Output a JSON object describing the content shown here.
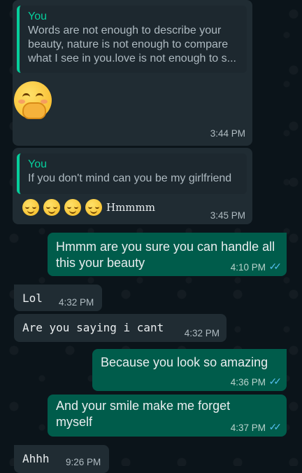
{
  "messages": [
    {
      "quote_name": "You",
      "quote_text": "Words are not enough to describe your beauty, nature is not enough to compare what I see in you.love is not enough to s...",
      "emoji": "shy-smile-emoji",
      "time": "3:44 PM"
    },
    {
      "quote_name": "You",
      "quote_text": "If you don't mind can you be my girlfriend",
      "text": "Hmmmm",
      "time": "3:45 PM"
    },
    {
      "text": "Hmmm are you sure you can handle all this your beauty",
      "time": "4:10 PM"
    },
    {
      "text": "Lol",
      "time": "4:32 PM"
    },
    {
      "text": "Are you saying i cant",
      "time": "4:32 PM"
    },
    {
      "text": "Because you look so amazing",
      "time": "4:36 PM"
    },
    {
      "text": "And your smile make me forget myself",
      "time": "4:37 PM"
    },
    {
      "text": "Ahhh",
      "time": "9:26 PM"
    }
  ],
  "colors": {
    "incoming": "#202c33",
    "outgoing": "#005c4b",
    "accent": "#06cf9c",
    "read_tick": "#53bdeb"
  }
}
